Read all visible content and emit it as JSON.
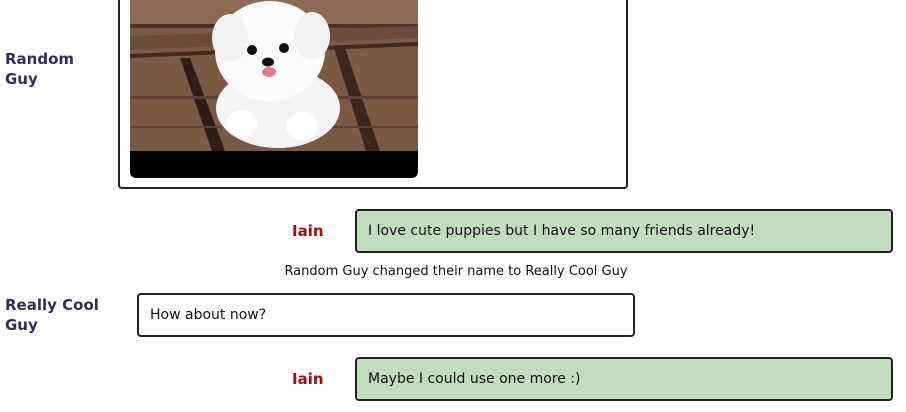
{
  "messages": [
    {
      "sender": "Random Guy",
      "type": "image",
      "image_description_icon": "puppy-photo"
    },
    {
      "sender": "Iain",
      "type": "text",
      "text": "I love cute puppies but I have so many friends already!"
    },
    {
      "type": "system",
      "text": "Random Guy changed their name to Really Cool Guy"
    },
    {
      "sender": "Really Cool Guy",
      "type": "text",
      "text": "How about now?"
    },
    {
      "sender": "Iain",
      "type": "text",
      "text": "Maybe I could use one more :)"
    }
  ],
  "colors": {
    "other_sender": "#2f2f5a",
    "self_sender": "#a50e0e",
    "self_bubble": "#c2dcbe",
    "other_bubble": "#ffffff"
  }
}
